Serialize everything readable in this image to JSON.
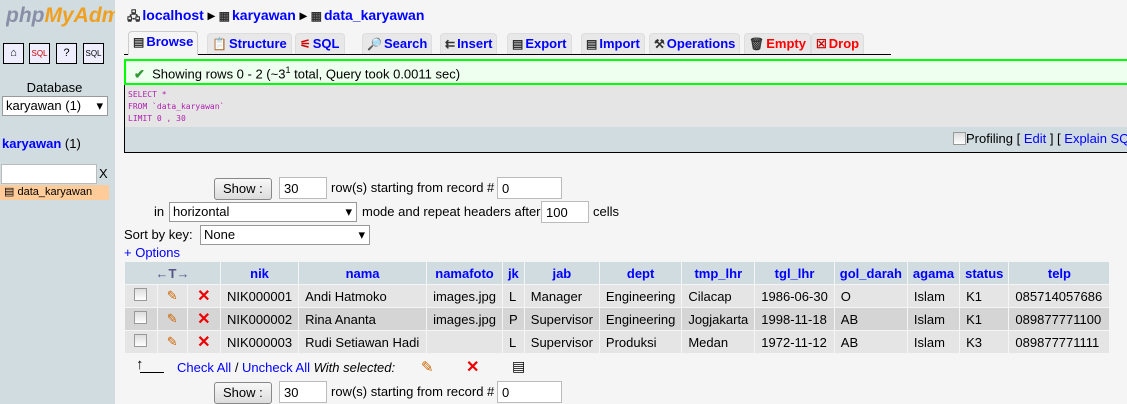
{
  "sidebar": {
    "logo": "phpMyAdmin",
    "logo_a": "php",
    "logo_b": "MyAdm",
    "database_label": "Database",
    "database_select": "karyawan (1)",
    "db_link": "karyawan",
    "db_count": "(1)",
    "filter_clear": "X",
    "tables": [
      "data_karyawan"
    ]
  },
  "breadcrumb": {
    "server": "localhost",
    "database": "karyawan",
    "table": "data_karyawan"
  },
  "tabs": [
    {
      "label": "Browse",
      "color": "#0000ff"
    },
    {
      "label": "Structure"
    },
    {
      "label": "SQL"
    },
    {
      "label": "Search"
    },
    {
      "label": "Insert"
    },
    {
      "label": "Export"
    },
    {
      "label": "Import"
    },
    {
      "label": "Operations"
    },
    {
      "label": "Empty",
      "color": "#ff0000"
    },
    {
      "label": "Drop",
      "color": "#ff0000"
    }
  ],
  "message": {
    "text_pre": "Showing rows 0 - 2 (~3",
    "sup": "1",
    "text_post": " total, Query took 0.0011 sec)",
    "border_color": "#00ff00"
  },
  "sql": {
    "line1": "SELECT *",
    "line2": "FROM `data_karyawan`",
    "line3": "LIMIT 0 , 30",
    "profiling": "Profiling",
    "edit": "Edit",
    "explain": "Explain SQL"
  },
  "nav": {
    "show": "Show :",
    "rows": "30",
    "rows_text": "row(s) starting from record #",
    "start": "0",
    "in": "in",
    "mode": "horizontal",
    "mode_text": "mode and repeat headers after",
    "headers": "100",
    "cells": "cells",
    "sort_label": "Sort by key:",
    "sort_value": "None",
    "options": "+ Options"
  },
  "table": {
    "columns": [
      "nik",
      "nama",
      "namafoto",
      "jk",
      "jab",
      "dept",
      "tmp_lhr",
      "tgl_lhr",
      "gol_darah",
      "agama",
      "status",
      "telp"
    ],
    "rows": [
      [
        "NIK000001",
        "Andi Hatmoko",
        "images.jpg",
        "L",
        "Manager",
        "Engineering",
        "Cilacap",
        "1986-06-30",
        "O",
        "Islam",
        "K1",
        "085714057686"
      ],
      [
        "NIK000002",
        "Rina Ananta",
        "images.jpg",
        "P",
        "Supervisor",
        "Engineering",
        "Jogjakarta",
        "1998-11-18",
        "AB",
        "Islam",
        "K1",
        "089877771100"
      ],
      [
        "NIK000003",
        "Rudi Setiawan Hadi",
        "",
        "L",
        "Supervisor",
        "Produksi",
        "Medan",
        "1972-11-12",
        "AB",
        "Islam",
        "K3",
        "089877771111"
      ]
    ]
  },
  "footer": {
    "check_all": "Check All",
    "sep": " / ",
    "uncheck_all": "Uncheck All",
    "with_selected": "With selected:"
  }
}
